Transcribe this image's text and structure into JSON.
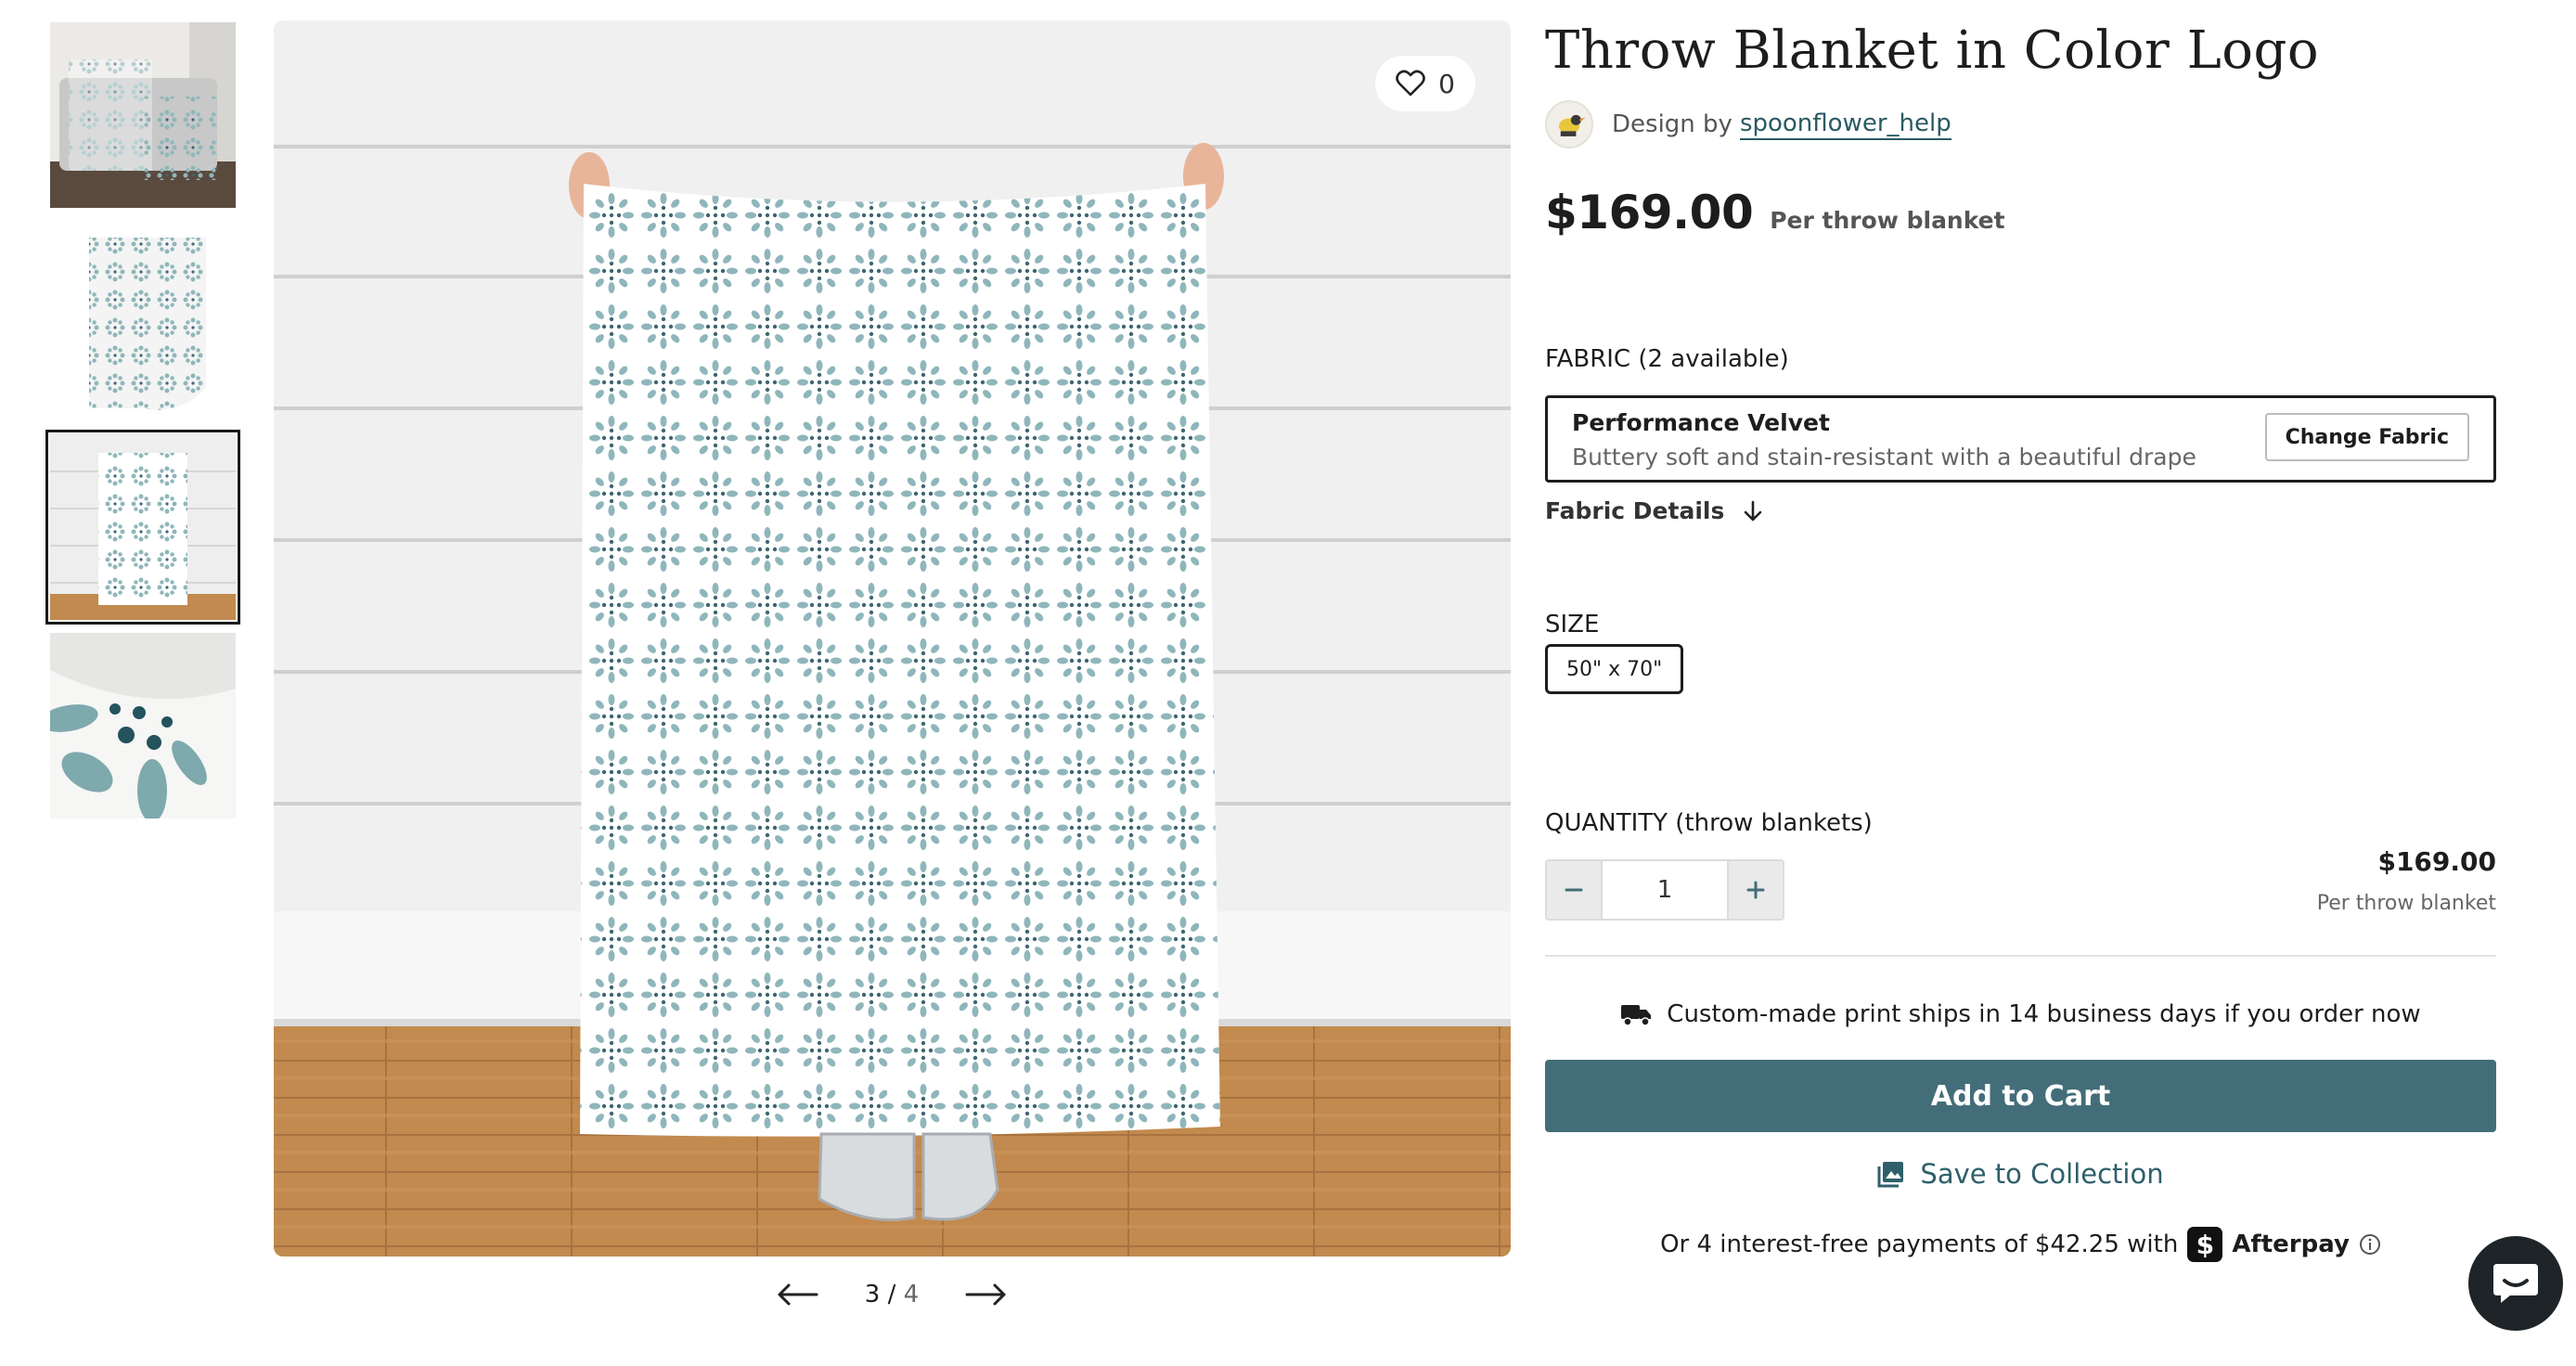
{
  "gallery": {
    "thumbnails": [
      {
        "name": "thumb-sofa"
      },
      {
        "name": "thumb-folded"
      },
      {
        "name": "thumb-held"
      },
      {
        "name": "thumb-closeup"
      }
    ],
    "selected_index": 3,
    "current": "3",
    "separator": "/",
    "total": "4",
    "favorites_count": "0"
  },
  "product": {
    "title": "Throw Blanket in Color Logo",
    "design_by_label": "Design by",
    "designer": "spoonflower_help",
    "price": "$169.00",
    "price_unit": "Per throw blanket"
  },
  "fabric": {
    "label": "FABRIC (2 available)",
    "name": "Performance Velvet",
    "description": "Buttery soft and stain-resistant with a beautiful drape",
    "change_label": "Change Fabric",
    "details_label": "Fabric Details"
  },
  "size": {
    "label": "SIZE",
    "selected": "50\" x 70\""
  },
  "quantity": {
    "label": "QUANTITY (throw blankets)",
    "value": "1",
    "line_total": "$169.00",
    "line_unit": "Per throw blanket"
  },
  "shipping": {
    "text": "Custom-made print ships in 14 business days if you order now"
  },
  "actions": {
    "add_to_cart": "Add to Cart",
    "save_to_collection": "Save to Collection"
  },
  "afterpay": {
    "text": "Or 4 interest-free payments of $42.25 with",
    "logo_glyph": "$",
    "brand": "Afterpay"
  },
  "colors": {
    "accent": "#436e79",
    "link": "#2a5a64",
    "pattern": "#8fb6bb",
    "floor": "#c28a4e"
  },
  "icons": [
    "heart-icon",
    "arrow-left-icon",
    "arrow-right-icon",
    "arrow-down-icon",
    "minus-icon",
    "plus-icon",
    "truck-icon",
    "collection-icon",
    "info-icon",
    "chat-icon"
  ]
}
